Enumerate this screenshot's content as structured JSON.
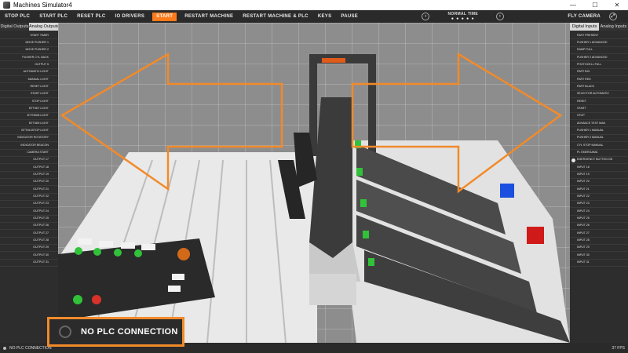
{
  "window": {
    "title": "Machines Simulator4",
    "minimize": "—",
    "maximize": "☐",
    "close": "✕"
  },
  "toolbar": {
    "buttons": [
      "STOP PLC",
      "START PLC",
      "RESET PLC",
      "IO DRIVERS",
      "START",
      "RESTART MACHINE",
      "RESTART MACHINE & PLC",
      "KEYS",
      "PAUSE"
    ],
    "active_index": 4,
    "time_label": "NORMAL TIME",
    "time_dots": "● ● ● ● ●",
    "camera_label": "FLY CAMERA"
  },
  "left_panel": {
    "tabs": [
      "Digital Outputs",
      "Analog Outputs"
    ],
    "items": [
      "START TIMER",
      "MOVE PUSHER 1",
      "MOVE PUSHER 2",
      "PUSHER CYL BACK",
      "OUTPUT 5",
      "AUTOMATIC LIGHT",
      "MANUAL LIGHT",
      "RESET LIGHT",
      "START LIGHT",
      "STOP LIGHT",
      "BTTN07 LIGHT",
      "BTTNS08 LIGHT",
      "BTTN09 LIGHT",
      "BTTN10STOP LIGHT",
      "INDICATOR ROTATORY",
      "INDICATOR BEACON",
      "CAMERA START",
      "OUTPUT 17",
      "OUTPUT 18",
      "OUTPUT 19",
      "OUTPUT 20",
      "OUTPUT 21",
      "OUTPUT 22",
      "OUTPUT 23",
      "OUTPUT 24",
      "OUTPUT 25",
      "OUTPUT 26",
      "OUTPUT 27",
      "OUTPUT 28",
      "OUTPUT 29",
      "OUTPUT 30",
      "OUTPUT 31"
    ]
  },
  "right_panel": {
    "tabs": [
      "Digital Inputs",
      "Analog Inputs"
    ],
    "items": [
      "PART PRESENT",
      "PUSHER 1 ADVANCED",
      "RAMP FULL",
      "PUSHER 2 ADVANCED",
      "PHOTOCELL FULL",
      "PART BIG",
      "PART RED",
      "PART BLACK",
      "SELECTOR AUTOMATIC",
      "RESET",
      "START",
      "STOP",
      "ADVANCE TEST MAN",
      "PUSHER 1 MANUAL",
      "PUSHER 2 MANUAL",
      "CYL STOP MANUAL",
      "PL EMERGAMA",
      "EMERGENCY BUTTON ON",
      "INPUT 18",
      "INPUT 19",
      "INPUT 20",
      "INPUT 21",
      "INPUT 22",
      "INPUT 23",
      "INPUT 24",
      "INPUT 25",
      "INPUT 26",
      "INPUT 27",
      "INPUT 28",
      "INPUT 29",
      "INPUT 30",
      "INPUT 31"
    ],
    "active_dot_index": 17
  },
  "status": {
    "connection": "NO PLC CONNECTION",
    "fps": "37 FPS"
  },
  "overlay": {
    "text": "NO PLC CONNECTION"
  },
  "colors": {
    "accent": "#ff7a1a",
    "arrow": "#f28a2a",
    "led_green": "#31c23a",
    "led_red": "#d8322a",
    "part_blue": "#1a4fe0",
    "part_red": "#d01a1a"
  },
  "icons": [
    "app-icon",
    "rewind-icon",
    "forward-icon",
    "expand-icon",
    "plc-status-icon"
  ]
}
